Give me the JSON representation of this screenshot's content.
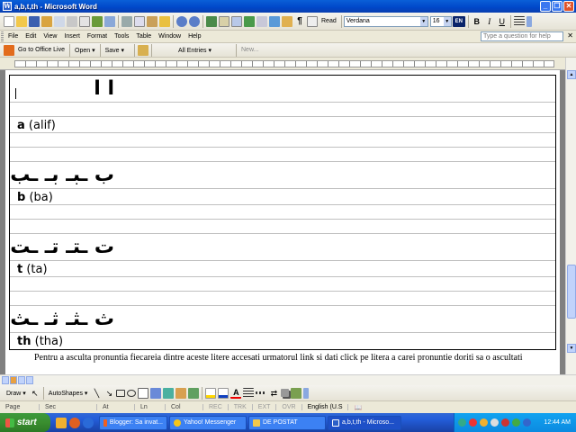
{
  "window": {
    "title": "a,b,t,th - Microsoft Word"
  },
  "toolbar": {
    "read_label": "Read",
    "style_value": "Normal + Left...",
    "font_value": "Verdana",
    "size_value": "16",
    "lang_value": "EN",
    "bold": "B",
    "italic": "I",
    "underline": "U"
  },
  "menu": {
    "items": [
      "File",
      "Edit",
      "View",
      "Insert",
      "Format",
      "Tools",
      "Table",
      "Window",
      "Help"
    ],
    "help_placeholder": "Type a question for help"
  },
  "toolbar2": {
    "office_live": "Go to Office Live",
    "open": "Open ▾",
    "save": "Save ▾",
    "all_entries": "All Entries ▾",
    "new": "New..."
  },
  "document": {
    "rows": [
      {
        "arabic": "ا ا",
        "label_bold": "a",
        "label_rest": " (alif)"
      },
      {
        "arabic": "ب ـبـ بـ ـب",
        "label_bold": "b",
        "label_rest": " (ba)"
      },
      {
        "arabic": "ت ـتـ تـ ـت",
        "label_bold": "t",
        "label_rest": " (ta)"
      },
      {
        "arabic": "ث ـثـ ثـ ـث",
        "label_bold": "th",
        "label_rest": " (tha)"
      }
    ],
    "paragraph": "Pentru a asculta pronuntia fiecareia dintre aceste litere accesati urmatorul link si dati click pe litera a carei pronuntie doriti sa o ascultati"
  },
  "drawbar": {
    "draw": "Draw ▾",
    "autoshapes": "AutoShapes ▾"
  },
  "status": {
    "page": "Page",
    "sec": "Sec",
    "at": "At",
    "ln": "Ln",
    "col": "Col",
    "rec": "REC",
    "trk": "TRK",
    "ext": "EXT",
    "ovr": "OVR",
    "language": "English (U.S"
  },
  "taskbar": {
    "start": "start",
    "tasks": [
      "Blogger: Sa invat...",
      "Yahoo! Messenger",
      "DE POSTAT",
      "a,b,t,th - Microso..."
    ],
    "clock": "12:44 AM"
  }
}
